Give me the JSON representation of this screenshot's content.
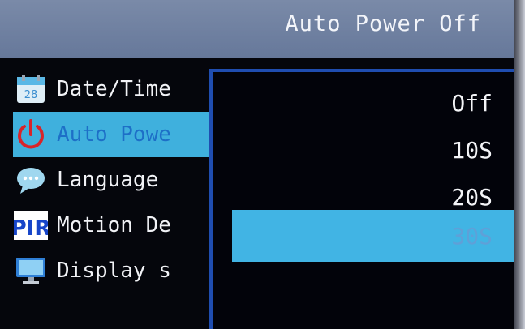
{
  "header": {
    "title": "Auto Power Off"
  },
  "menu": {
    "items": [
      {
        "label": "Date/Time",
        "icon": "calendar-icon",
        "value": "28"
      },
      {
        "label": "Auto Powe",
        "icon": "power-icon"
      },
      {
        "label": "Language",
        "icon": "speech-bubble-icon"
      },
      {
        "label": "Motion De",
        "icon": "pir-icon",
        "value": "PIR"
      },
      {
        "label": "Display s",
        "icon": "monitor-icon"
      }
    ],
    "selected_index": 1
  },
  "dropdown": {
    "options": [
      "Off",
      "10S",
      "20S",
      "30S"
    ],
    "selected": "30S"
  },
  "colors": {
    "title_bar": "#6e7f9c",
    "selection": "#41b4e4",
    "dropdown_border": "#1f4db0",
    "background": "#05060c"
  }
}
